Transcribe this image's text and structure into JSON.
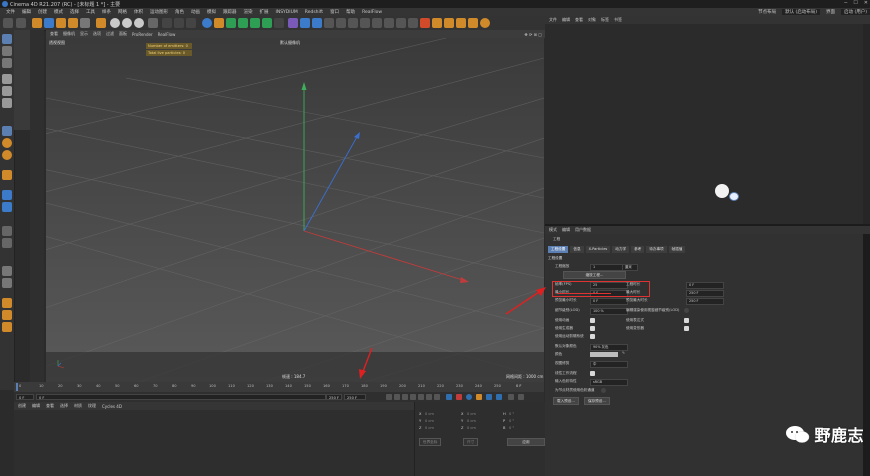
{
  "window": {
    "title": "Cinema 4D R21.207 (RC) - [未标题 1 *] - 主要"
  },
  "menubar": {
    "items": [
      "文件",
      "编辑",
      "创建",
      "模式",
      "选择",
      "工具",
      "样条",
      "网格",
      "体积",
      "运动图形",
      "角色",
      "动画",
      "模拟",
      "跟踪器",
      "渲染",
      "扩展",
      "INSYDIUM",
      "Redshift",
      "窗口",
      "帮助",
      "RealFlow"
    ],
    "right": [
      "界面",
      "启动 (用户)"
    ]
  },
  "viewport": {
    "menu": [
      "查看",
      "摄像机",
      "显示",
      "选项",
      "过滤",
      "面板",
      "ProRender",
      "RealFlow"
    ],
    "label_tl": "透视视图",
    "camera": "默认摄像机",
    "info": [
      "Number of emitters: 0",
      "Total live particles: 0"
    ],
    "footer_center": "帧速 : 184.7",
    "footer_right": "网格间距 : 1000 cm"
  },
  "timeline": {
    "ticks": [
      "0",
      "10",
      "20",
      "30",
      "40",
      "50",
      "60",
      "70",
      "80",
      "90",
      "100",
      "110",
      "120",
      "130",
      "140",
      "150",
      "160",
      "170",
      "180",
      "190",
      "200",
      "210",
      "220",
      "230",
      "240",
      "250"
    ],
    "end_frame": "0 F"
  },
  "playbar": {
    "current": "0 F",
    "start": "0 F",
    "end": "250 F",
    "end2": "250 F"
  },
  "material": {
    "menu": [
      "创建",
      "编辑",
      "查看",
      "选择",
      "材质",
      "纹理",
      "Cycles 4D"
    ]
  },
  "coords": {
    "labels": [
      "X",
      "Y",
      "Z",
      "X",
      "Y",
      "Z",
      "H",
      "P",
      "B"
    ],
    "values": [
      "0 cm",
      "0 cm",
      "0 cm",
      "0 cm",
      "0 cm",
      "0 cm",
      "0 °",
      "0 °",
      "0 °"
    ],
    "mode": "世界坐标",
    "size": "尺寸",
    "apply": "应用"
  },
  "object_manager": {
    "menu": [
      "文件",
      "编辑",
      "查看",
      "对象",
      "标签",
      "书签"
    ],
    "layout_label": "节点布局",
    "layout_value": "默认 (启动布局)",
    "search": "界面",
    "mode": "启动 (用户)"
  },
  "attributes": {
    "menu": [
      "模式",
      "编辑",
      "用户数据"
    ],
    "section": "工程",
    "tabs": [
      "工程设置",
      "信息",
      "X-Particles",
      "动力学",
      "参考",
      "待办事项",
      "帧插值"
    ],
    "group": "工程设置",
    "scale_label": "工程缩放",
    "scale_value": "1",
    "scale_unit": "厘米",
    "scale_button": "缩放工程...",
    "fps_label": "帧率(FPS)",
    "fps_value": "25",
    "project_time_label": "工程时长",
    "project_time_value": "0 F",
    "min_time_label": "最小时长",
    "min_time_value": "0 F",
    "max_time_label": "最大时长",
    "max_time_value": "250 F",
    "preview_min_label": "预览最小时长",
    "preview_min_value": "0 F",
    "preview_max_label": "预览最大时长",
    "preview_max_value": "250 F",
    "lod_label": "细节级别(LOD)",
    "lod_value": "100 %",
    "lod_render_label": "编辑渲染使用视窗细节级别(LOD)",
    "checks_left": [
      "使用动画",
      "使用生成器",
      "使用运动剪辑系统"
    ],
    "checks_right": [
      "使用表达式",
      "使用变形器"
    ],
    "default_color_label": "默认对象颜色",
    "default_color_value": "90% 灰色",
    "color_label": "颜色",
    "view_clip_label": "视图修剪",
    "view_clip_value": "中",
    "linear_label": "线性工作流程",
    "input_color_label": "输入色彩特性",
    "input_color_value": "sRGB",
    "node_label": "为节点材质使用色彩通道",
    "load_preset": "载入预设...",
    "save_preset": "保存预设..."
  },
  "watermark": {
    "text": "野鹿志"
  },
  "colors": {
    "accent": "#5c7fb2",
    "highlight": "#d33333",
    "axis_y": "#3fae5a",
    "axis_z": "#3a6fd0",
    "axis_x": "#c23b3b"
  }
}
